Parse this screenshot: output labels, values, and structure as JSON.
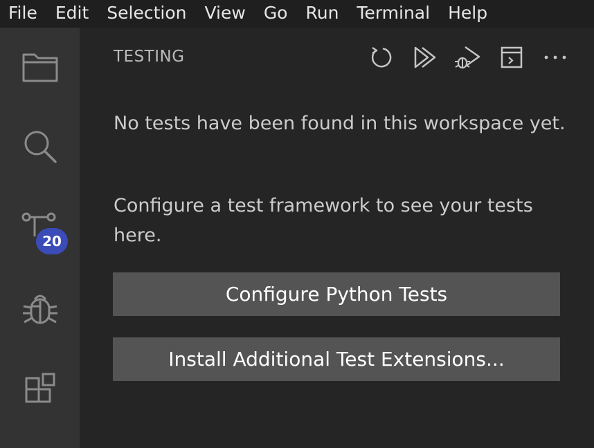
{
  "menubar": {
    "items": [
      "File",
      "Edit",
      "Selection",
      "View",
      "Go",
      "Run",
      "Terminal",
      "Help"
    ]
  },
  "activity_bar": {
    "items": [
      {
        "id": "explorer",
        "icon": "files-icon"
      },
      {
        "id": "search",
        "icon": "search-icon"
      },
      {
        "id": "source-control",
        "icon": "source-control-icon",
        "badge": "20"
      },
      {
        "id": "run-debug",
        "icon": "debug-icon"
      },
      {
        "id": "extensions",
        "icon": "extensions-icon"
      }
    ]
  },
  "panel": {
    "title": "TESTING",
    "toolbar": [
      {
        "id": "refresh-tests",
        "icon": "refresh-icon"
      },
      {
        "id": "run-all-tests",
        "icon": "run-all-icon"
      },
      {
        "id": "debug-all-tests",
        "icon": "debug-all-icon"
      },
      {
        "id": "show-output",
        "icon": "terminal-output-icon"
      },
      {
        "id": "more-actions",
        "icon": "ellipsis-icon"
      }
    ],
    "message_1": "No tests have been found in this workspace yet.",
    "message_2": "Configure a test framework to see your tests here.",
    "button_configure": "Configure Python Tests",
    "button_install": "Install Additional Test Extensions..."
  },
  "colors": {
    "menubar_bg": "#1f1f1f",
    "activitybar_bg": "#333333",
    "sidebar_bg": "#252526",
    "badge_bg": "#3b4cb8",
    "button_bg": "#545454"
  }
}
